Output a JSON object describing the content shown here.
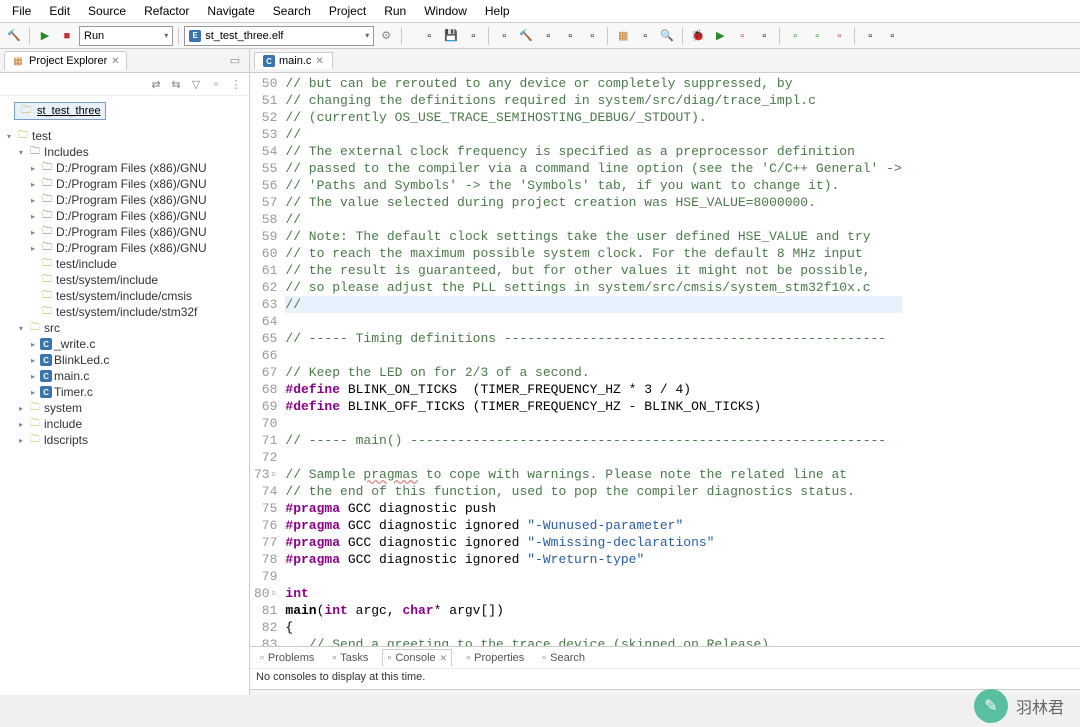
{
  "menu": {
    "items": [
      "File",
      "Edit",
      "Source",
      "Refactor",
      "Navigate",
      "Search",
      "Project",
      "Run",
      "Window",
      "Help"
    ]
  },
  "toolbar": {
    "run_mode": "Run",
    "launch_target": "st_test_three.elf"
  },
  "project_explorer": {
    "title": "Project Explorer",
    "selected_project": "st_test_three",
    "tree": [
      {
        "indent": 0,
        "arrow": "▾",
        "icon": "folder",
        "label": "test"
      },
      {
        "indent": 1,
        "arrow": "▾",
        "icon": "inc",
        "label": "Includes"
      },
      {
        "indent": 2,
        "arrow": "▸",
        "icon": "inc",
        "label": "D:/Program Files (x86)/GNU"
      },
      {
        "indent": 2,
        "arrow": "▸",
        "icon": "inc",
        "label": "D:/Program Files (x86)/GNU"
      },
      {
        "indent": 2,
        "arrow": "▸",
        "icon": "inc",
        "label": "D:/Program Files (x86)/GNU"
      },
      {
        "indent": 2,
        "arrow": "▸",
        "icon": "inc",
        "label": "D:/Program Files (x86)/GNU"
      },
      {
        "indent": 2,
        "arrow": "▸",
        "icon": "inc",
        "label": "D:/Program Files (x86)/GNU"
      },
      {
        "indent": 2,
        "arrow": "▸",
        "icon": "inc",
        "label": "D:/Program Files (x86)/GNU"
      },
      {
        "indent": 2,
        "arrow": "",
        "icon": "folder-c",
        "label": "test/include"
      },
      {
        "indent": 2,
        "arrow": "",
        "icon": "folder-c",
        "label": "test/system/include"
      },
      {
        "indent": 2,
        "arrow": "",
        "icon": "folder-c",
        "label": "test/system/include/cmsis"
      },
      {
        "indent": 2,
        "arrow": "",
        "icon": "folder-c",
        "label": "test/system/include/stm32f"
      },
      {
        "indent": 1,
        "arrow": "▾",
        "icon": "folder",
        "label": "src"
      },
      {
        "indent": 2,
        "arrow": "▸",
        "icon": "c",
        "label": "_write.c"
      },
      {
        "indent": 2,
        "arrow": "▸",
        "icon": "c",
        "label": "BlinkLed.c"
      },
      {
        "indent": 2,
        "arrow": "▸",
        "icon": "c",
        "label": "main.c"
      },
      {
        "indent": 2,
        "arrow": "▸",
        "icon": "c",
        "label": "Timer.c"
      },
      {
        "indent": 1,
        "arrow": "▸",
        "icon": "folder",
        "label": "system"
      },
      {
        "indent": 1,
        "arrow": "▸",
        "icon": "folder",
        "label": "include"
      },
      {
        "indent": 1,
        "arrow": "▸",
        "icon": "folder",
        "label": "ldscripts"
      }
    ]
  },
  "editor": {
    "tab": "main.c",
    "first_line": 50,
    "highlight_line": 63,
    "lines": [
      {
        "t": "comment",
        "text": "// but can be rerouted to any device or completely suppressed, by"
      },
      {
        "t": "comment",
        "text": "// changing the definitions required in system/src/diag/trace_impl.c"
      },
      {
        "t": "comment",
        "text": "// (currently OS_USE_TRACE_SEMIHOSTING_DEBUG/_STDOUT)."
      },
      {
        "t": "comment",
        "text": "//"
      },
      {
        "t": "comment",
        "text": "// The external clock frequency is specified as a preprocessor definition"
      },
      {
        "t": "comment",
        "text": "// passed to the compiler via a command line option (see the 'C/C++ General' ->"
      },
      {
        "t": "comment",
        "text": "// 'Paths and Symbols' -> the 'Symbols' tab, if you want to change it)."
      },
      {
        "t": "comment",
        "text": "// The value selected during project creation was HSE_VALUE=8000000."
      },
      {
        "t": "comment",
        "text": "//"
      },
      {
        "t": "comment",
        "text": "// Note: The default clock settings take the user defined HSE_VALUE and try"
      },
      {
        "t": "comment",
        "text": "// to reach the maximum possible system clock. For the default 8 MHz input"
      },
      {
        "t": "comment",
        "text": "// the result is guaranteed, but for other values it might not be possible,"
      },
      {
        "t": "comment",
        "text": "// so please adjust the PLL settings in system/src/cmsis/system_stm32f10x.c"
      },
      {
        "t": "comment",
        "text": "//"
      },
      {
        "t": "blank",
        "text": ""
      },
      {
        "t": "comment",
        "text": "// ----- Timing definitions -------------------------------------------------"
      },
      {
        "t": "blank",
        "text": ""
      },
      {
        "t": "comment",
        "text": "// Keep the LED on for 2/3 of a second."
      },
      {
        "t": "define",
        "kw": "#define",
        "text": " BLINK_ON_TICKS  (TIMER_FREQUENCY_HZ * 3 / 4)"
      },
      {
        "t": "define",
        "kw": "#define",
        "text": " BLINK_OFF_TICKS (TIMER_FREQUENCY_HZ - BLINK_ON_TICKS)"
      },
      {
        "t": "blank",
        "text": ""
      },
      {
        "t": "comment",
        "text": "// ----- main() -------------------------------------------------------------"
      },
      {
        "t": "blank",
        "text": ""
      },
      {
        "t": "comment_warn",
        "pre": "// Sample ",
        "warn": "pragmas",
        "post": " to cope with warnings. Please note the related line at"
      },
      {
        "t": "comment",
        "text": "// the end of this function, used to pop the compiler diagnostics status."
      },
      {
        "t": "pragma",
        "kw": "#pragma",
        "text": " GCC diagnostic push"
      },
      {
        "t": "pragma_str",
        "kw": "#pragma",
        "mid": " GCC diagnostic ignored ",
        "str": "\"-Wunused-parameter\""
      },
      {
        "t": "pragma_str",
        "kw": "#pragma",
        "mid": " GCC diagnostic ignored ",
        "str": "\"-Wmissing-declarations\""
      },
      {
        "t": "pragma_str",
        "kw": "#pragma",
        "mid": " GCC diagnostic ignored ",
        "str": "\"-Wreturn-type\""
      },
      {
        "t": "blank",
        "text": ""
      },
      {
        "t": "kw",
        "text": "int"
      },
      {
        "t": "main",
        "func": "main",
        "sig1": "int",
        "mid1": " argc, ",
        "sig2": "char",
        "mid2": "* argv[])"
      },
      {
        "t": "plain",
        "text": "{"
      },
      {
        "t": "comment",
        "text": "   // Send a greeting to the trace device (skipped on Release)."
      }
    ]
  },
  "bottom": {
    "tabs": [
      "Problems",
      "Tasks",
      "Console",
      "Properties",
      "Search"
    ],
    "active": "Console",
    "message": "No consoles to display at this time."
  },
  "watermark": "羽林君"
}
